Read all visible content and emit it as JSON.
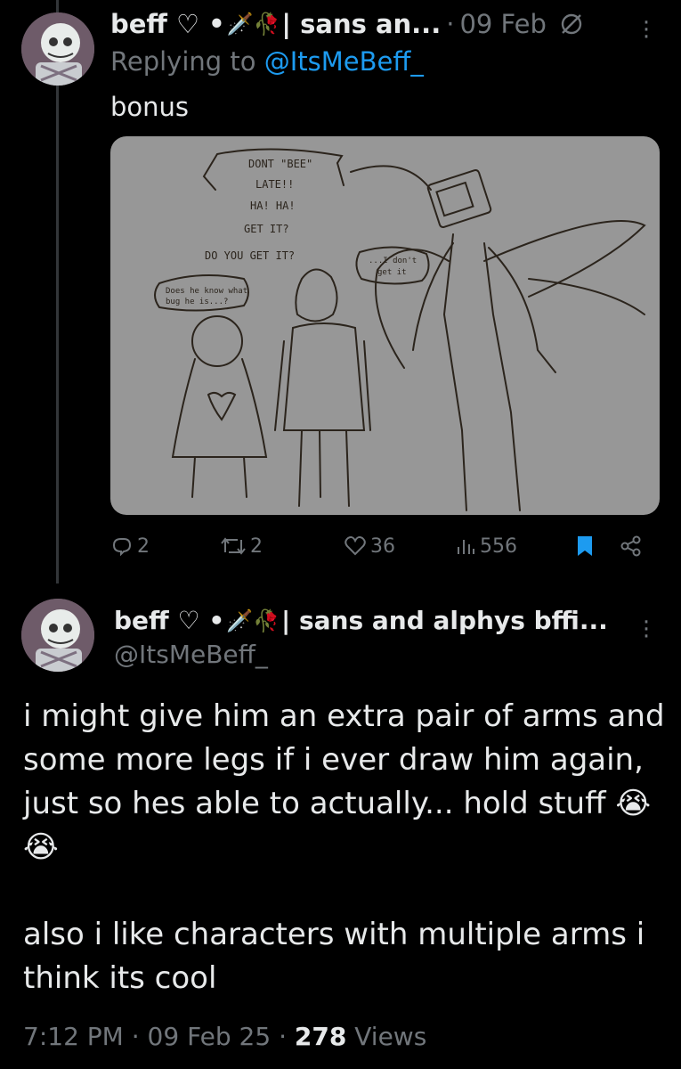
{
  "reply_tweet": {
    "display_name": "beff ♡ •",
    "name_emojis": "🗡️🥀",
    "name_suffix": "| sans an...",
    "date": "09 Feb",
    "replying_prefix": "Replying to",
    "replying_handle": "@ItsMeBeff_",
    "text": "bonus",
    "drawing_texts": {
      "speech1_l1": "DONT \"BEE\"",
      "speech1_l2": "LATE!!",
      "speech1_l3": "HA! HA!",
      "speech1_l4": "GET IT?",
      "speech1_l5": "DO YOU GET IT?",
      "speech2_l1": "Does he know what",
      "speech2_l2": "bug he is...?",
      "speech3_l1": "...I don't",
      "speech3_l2": "get it"
    },
    "stats": {
      "replies": "2",
      "reposts": "2",
      "likes": "36",
      "views": "556"
    }
  },
  "main_tweet": {
    "display_name": "beff ♡ •",
    "name_emojis": "🗡️🥀",
    "name_suffix": "| sans and alphys bffi...",
    "handle": "@ItsMeBeff_",
    "text": "i might give him an extra pair of arms and some more legs if i ever draw him again, just so hes able to actually... hold stuff 😭😭\n\nalso i like characters with multiple arms i think its cool",
    "time": "7:12 PM",
    "date": "09 Feb 25",
    "views_count": "278",
    "views_label": "Views"
  },
  "colors": {
    "background": "#000000",
    "text": "#e7e9ea",
    "muted": "#71767b",
    "link": "#1d9bf0",
    "bookmark": "#1d9bf0"
  }
}
